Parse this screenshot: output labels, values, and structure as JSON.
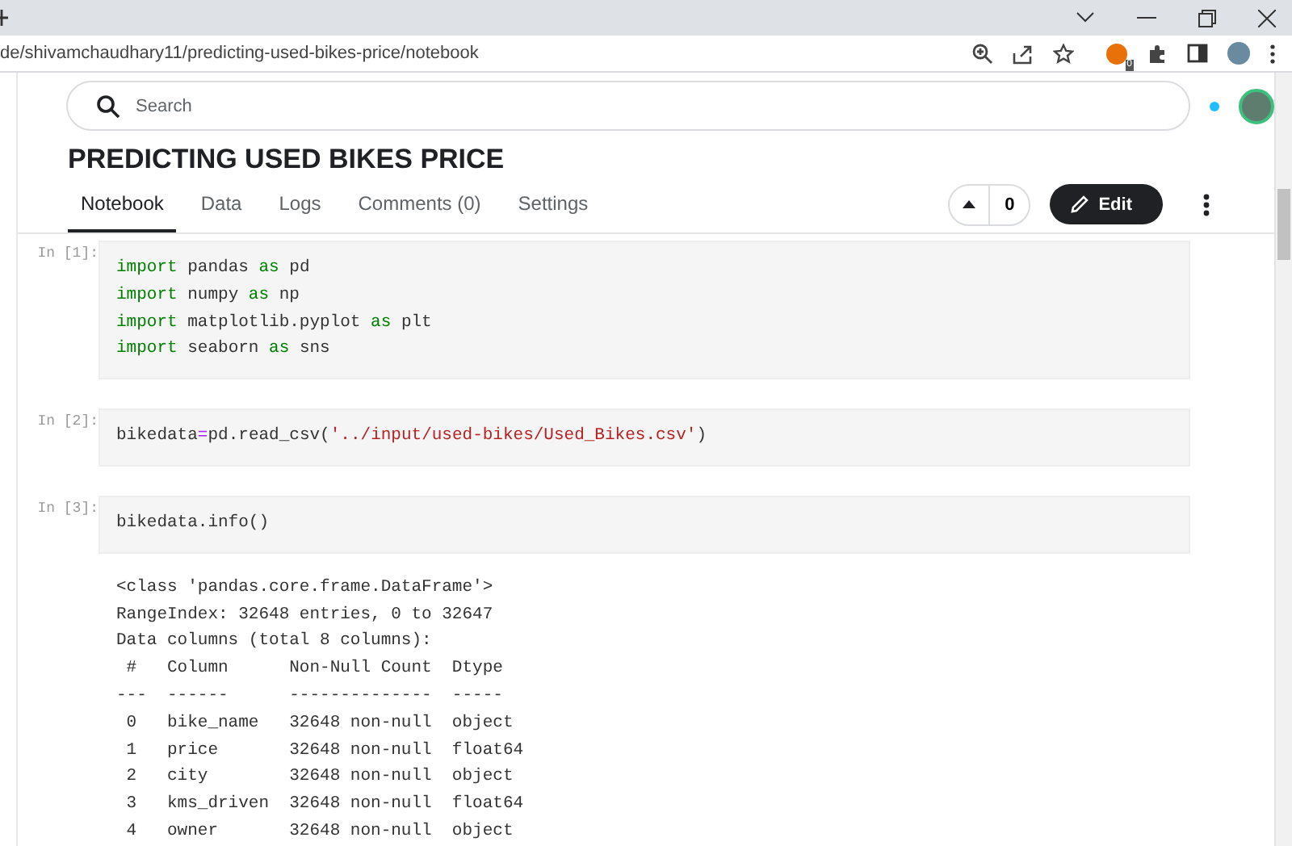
{
  "browser": {
    "url": "de/shivamchaudhary11/predicting-used-bikes-price/notebook",
    "extension_badge": "0"
  },
  "search": {
    "placeholder": "Search"
  },
  "title": "PREDICTING USED BIKES PRICE",
  "tabs": [
    {
      "label": "Notebook",
      "selected": true
    },
    {
      "label": "Data",
      "selected": false
    },
    {
      "label": "Logs",
      "selected": false
    },
    {
      "label": "Comments (0)",
      "selected": false
    },
    {
      "label": "Settings",
      "selected": false
    }
  ],
  "vote_count": "0",
  "edit_button": "Edit",
  "cells": [
    {
      "prompt": "In [1]:",
      "lines": [
        [
          {
            "text": "import",
            "kind": "kw"
          },
          {
            "text": " pandas ",
            "kind": "plain"
          },
          {
            "text": "as",
            "kind": "kw"
          },
          {
            "text": " pd",
            "kind": "plain"
          }
        ],
        [
          {
            "text": "import",
            "kind": "kw"
          },
          {
            "text": " numpy ",
            "kind": "plain"
          },
          {
            "text": "as",
            "kind": "kw"
          },
          {
            "text": " np",
            "kind": "plain"
          }
        ],
        [
          {
            "text": "import",
            "kind": "kw"
          },
          {
            "text": " matplotlib.pyplot ",
            "kind": "plain"
          },
          {
            "text": "as",
            "kind": "kw"
          },
          {
            "text": " plt",
            "kind": "plain"
          }
        ],
        [
          {
            "text": "import",
            "kind": "kw"
          },
          {
            "text": " seaborn ",
            "kind": "plain"
          },
          {
            "text": "as",
            "kind": "kw"
          },
          {
            "text": " sns",
            "kind": "plain"
          }
        ]
      ]
    },
    {
      "prompt": "In [2]:",
      "lines": [
        [
          {
            "text": "bikedata",
            "kind": "plain"
          },
          {
            "text": "=",
            "kind": "op"
          },
          {
            "text": "pd.read_csv(",
            "kind": "plain"
          },
          {
            "text": "'../input/used-bikes/Used_Bikes.csv'",
            "kind": "str"
          },
          {
            "text": ")",
            "kind": "plain"
          }
        ]
      ]
    },
    {
      "prompt": "In [3]:",
      "lines": [
        [
          {
            "text": "bikedata.info()",
            "kind": "plain"
          }
        ]
      ],
      "output": [
        "<class 'pandas.core.frame.DataFrame'>",
        "RangeIndex: 32648 entries, 0 to 32647",
        "Data columns (total 8 columns):",
        " #   Column      Non-Null Count  Dtype  ",
        "---  ------      --------------  -----  ",
        " 0   bike_name   32648 non-null  object ",
        " 1   price       32648 non-null  float64",
        " 2   city        32648 non-null  object ",
        " 3   kms_driven  32648 non-null  float64",
        " 4   owner       32648 non-null  object "
      ]
    }
  ]
}
